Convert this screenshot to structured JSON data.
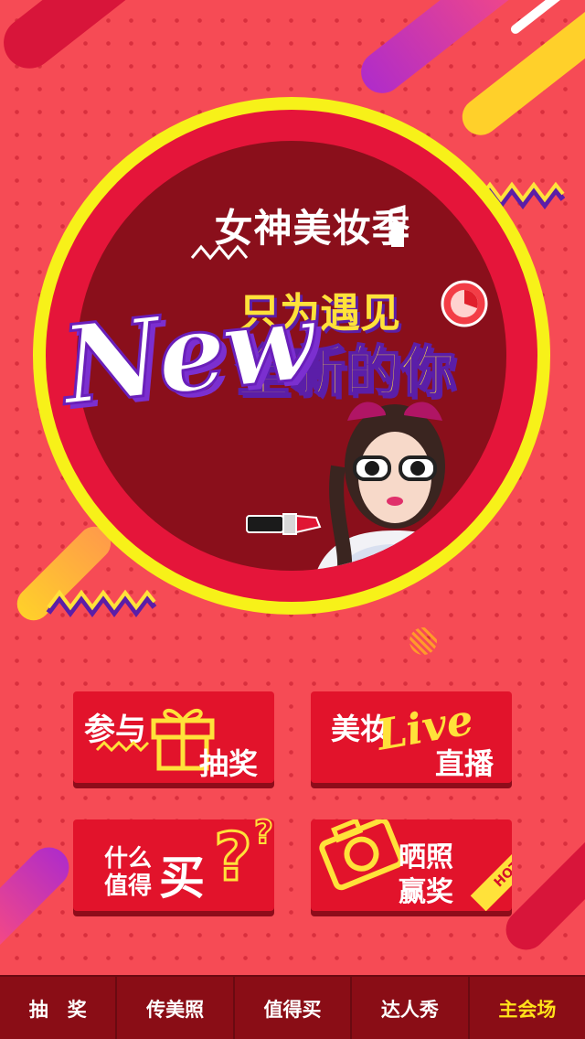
{
  "banner": {
    "logo_text": "女神美妆季",
    "headline_top": "只为遇见",
    "headline_main": "全新的你",
    "script_word": "New"
  },
  "tiles": {
    "lottery": {
      "line1": "参与",
      "line2": "抽奖"
    },
    "live": {
      "line1": "美妆",
      "script": "Live",
      "line2": "直播"
    },
    "worth": {
      "line1": "什么",
      "line2": "值得",
      "big": "买"
    },
    "photo": {
      "line1": "晒照",
      "line2": "赢奖",
      "badge": "HOT"
    }
  },
  "tabbar": {
    "items": [
      {
        "label": "抽　奖"
      },
      {
        "label": "传美照"
      },
      {
        "label": "值得买"
      },
      {
        "label": "达人秀"
      },
      {
        "label": "主会场"
      }
    ],
    "active_index": 4
  },
  "colors": {
    "background": "#f64b55",
    "yellow": "#f7f119",
    "accent_red": "#e5153a",
    "purple": "#7b2fd0",
    "tabbar": "#8a0d16",
    "active_tab": "#ffe21a"
  }
}
